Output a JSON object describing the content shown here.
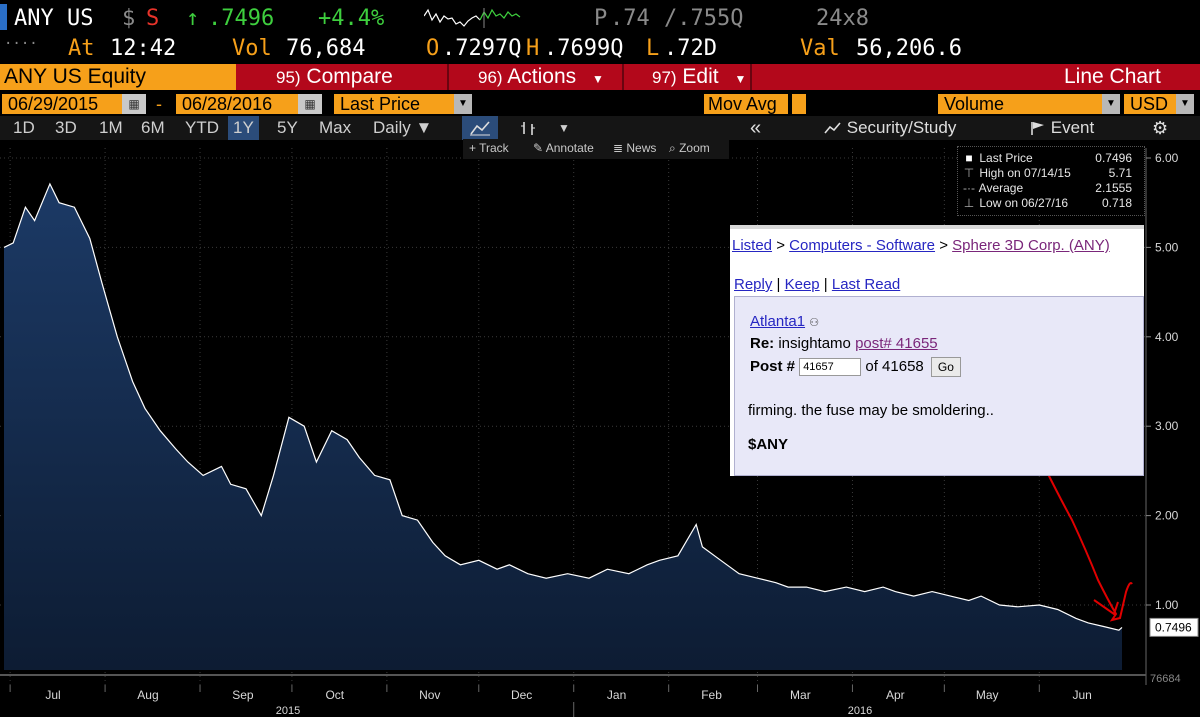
{
  "ticker": {
    "symbol": "ANY US",
    "dollar": "$",
    "currency_code": "S",
    "arrow": "↑",
    "last": ".7496",
    "change_pct": "+4.4%",
    "bid_ask_prefix": "P",
    "bid": ".74",
    "ask": "/.755Q",
    "size": "24x8"
  },
  "row2": {
    "time_label": "At",
    "time": "12:42",
    "vol_label": "Vol",
    "vol": "76,684",
    "open_label": "O",
    "open": ".7297Q",
    "high_label": "H",
    "high": ".7699Q",
    "low_label": "L",
    "low": ".72D",
    "val_label": "Val",
    "val": "56,206.6"
  },
  "function_bar": {
    "security": "ANY US Equity",
    "compare_num": "95)",
    "compare": "Compare",
    "actions_num": "96)",
    "actions": "Actions",
    "edit_num": "97)",
    "edit": "Edit",
    "chart_type": "Line Chart"
  },
  "inputs": {
    "start_date": "06/29/2015",
    "dash": "-",
    "end_date": "06/28/2016",
    "field": "Last Price",
    "mov_avg": "Mov Avg",
    "volume": "Volume",
    "currency": "USD"
  },
  "range_buttons": [
    "1D",
    "3D",
    "1M",
    "6M",
    "YTD",
    "1Y",
    "5Y",
    "Max"
  ],
  "active_range": "1Y",
  "periodicity": "Daily ▼",
  "range_right": {
    "back": "«",
    "security_study": "Security/Study",
    "event": "Event"
  },
  "mini_toolbar": {
    "track": "Track",
    "annotate": "Annotate",
    "news": "News",
    "zoom": "Zoom"
  },
  "legend": {
    "last_price_label": "Last Price",
    "last_price": "0.7496",
    "high_label": "High on 07/14/15",
    "high": "5.71",
    "average_label": "Average",
    "average": "2.1555",
    "low_label": "Low on 06/27/16",
    "low": "0.718"
  },
  "forum": {
    "crumb_listed": "Listed",
    "crumb_sep1": ">",
    "crumb_category": "Computers - Software",
    "crumb_sep2": ">",
    "crumb_company": "Sphere 3D Corp. (ANY)",
    "reply": "Reply",
    "keep": "Keep",
    "last_read": "Last Read",
    "author": "Atlanta1",
    "re_label": "Re:",
    "re_user": "insightamo",
    "re_post": "post# 41655",
    "post_label": "Post #",
    "post_input": "41657",
    "post_of": "of 41658",
    "go": "Go",
    "body": "firming. the fuse may be smoldering..",
    "tag": "$ANY"
  },
  "current_price_label": "0.7496",
  "volume_box": "76684",
  "colors": {
    "bloomberg_orange": "#f6a01a",
    "bar_red": "#b3081b",
    "price_green": "#3ecf3e",
    "area_fill": "#13294a",
    "annotation_red": "#e00000"
  },
  "chart_data": {
    "type": "area",
    "title": "",
    "xlabel": "",
    "ylabel": "",
    "ylim": [
      0.45,
      6.2
    ],
    "y_ticks": [
      "6.00",
      "5.00",
      "4.00",
      "3.00",
      "2.00",
      "1.00"
    ],
    "x_tick_labels": [
      "Jul",
      "Aug",
      "Sep",
      "Oct",
      "Nov",
      "Dec",
      "Jan",
      "Feb",
      "Mar",
      "Apr",
      "May",
      "Jun"
    ],
    "year_labels": [
      "2015",
      "2016"
    ],
    "grid": true,
    "series": [
      {
        "x": [
          "2015-06-29",
          "2015-07-02",
          "2015-07-06",
          "2015-07-09",
          "2015-07-14",
          "2015-07-17",
          "2015-07-22",
          "2015-07-27",
          "2015-07-31",
          "2015-08-05",
          "2015-08-10",
          "2015-08-14",
          "2015-08-19",
          "2015-08-24",
          "2015-08-28",
          "2015-09-02",
          "2015-09-08",
          "2015-09-11",
          "2015-09-16",
          "2015-09-21",
          "2015-09-25",
          "2015-09-30",
          "2015-10-05",
          "2015-10-09",
          "2015-10-14",
          "2015-10-19",
          "2015-10-23",
          "2015-10-28",
          "2015-11-02",
          "2015-11-06",
          "2015-11-11",
          "2015-11-16",
          "2015-11-20",
          "2015-11-25",
          "2015-12-01",
          "2015-12-07",
          "2015-12-11",
          "2015-12-17",
          "2015-12-23",
          "2015-12-30",
          "2016-01-06",
          "2016-01-12",
          "2016-01-19",
          "2016-01-25",
          "2016-01-29",
          "2016-02-04",
          "2016-02-10",
          "2016-02-12",
          "2016-02-18",
          "2016-02-24",
          "2016-03-01",
          "2016-03-07",
          "2016-03-11",
          "2016-03-17",
          "2016-03-23",
          "2016-03-30",
          "2016-04-05",
          "2016-04-11",
          "2016-04-15",
          "2016-04-21",
          "2016-04-27",
          "2016-05-03",
          "2016-05-09",
          "2016-05-13",
          "2016-05-19",
          "2016-05-25",
          "2016-06-01",
          "2016-06-07",
          "2016-06-13",
          "2016-06-17",
          "2016-06-22",
          "2016-06-27",
          "2016-06-28"
        ],
        "values": [
          5.0,
          5.05,
          5.45,
          5.3,
          5.71,
          5.5,
          5.45,
          5.1,
          4.6,
          4.0,
          3.5,
          3.2,
          2.95,
          2.75,
          2.6,
          2.45,
          2.55,
          2.35,
          2.3,
          2.0,
          2.45,
          3.1,
          3.0,
          2.6,
          2.95,
          2.85,
          2.65,
          2.45,
          2.4,
          2.0,
          1.95,
          1.7,
          1.55,
          1.45,
          1.5,
          1.4,
          1.45,
          1.35,
          1.3,
          1.35,
          1.3,
          1.4,
          1.35,
          1.45,
          1.5,
          1.55,
          1.9,
          1.65,
          1.5,
          1.35,
          1.3,
          1.25,
          1.2,
          1.2,
          1.15,
          1.2,
          1.15,
          1.2,
          1.15,
          1.1,
          1.15,
          1.1,
          1.05,
          1.1,
          1.0,
          0.98,
          1.0,
          0.95,
          0.85,
          0.8,
          0.76,
          0.718,
          0.7496
        ]
      }
    ]
  }
}
